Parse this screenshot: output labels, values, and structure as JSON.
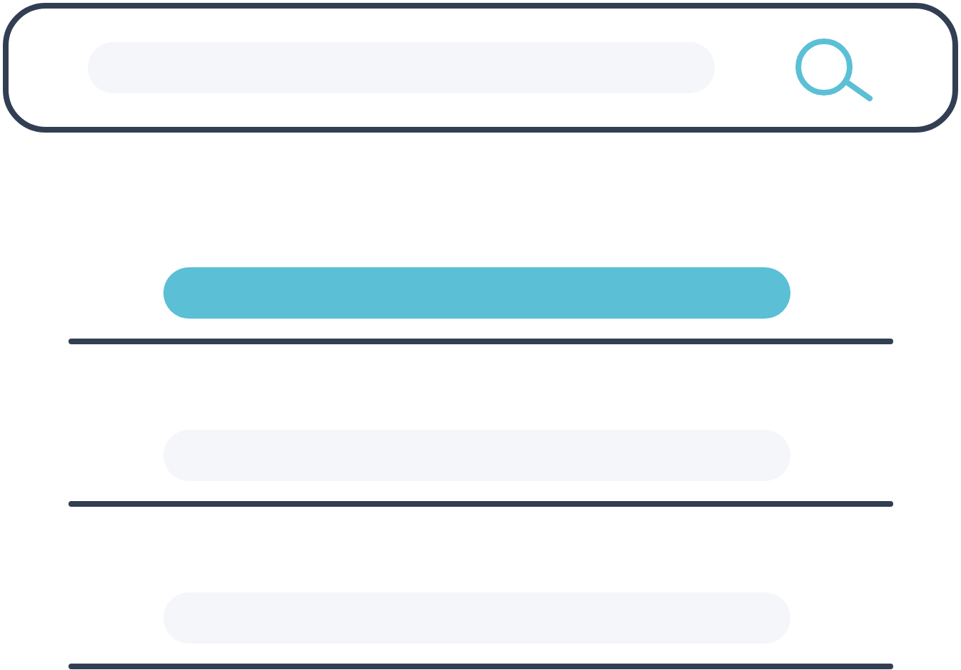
{
  "search": {
    "focused": false
  },
  "results": [
    {
      "selected": true
    },
    {
      "selected": false
    },
    {
      "selected": false
    }
  ]
}
